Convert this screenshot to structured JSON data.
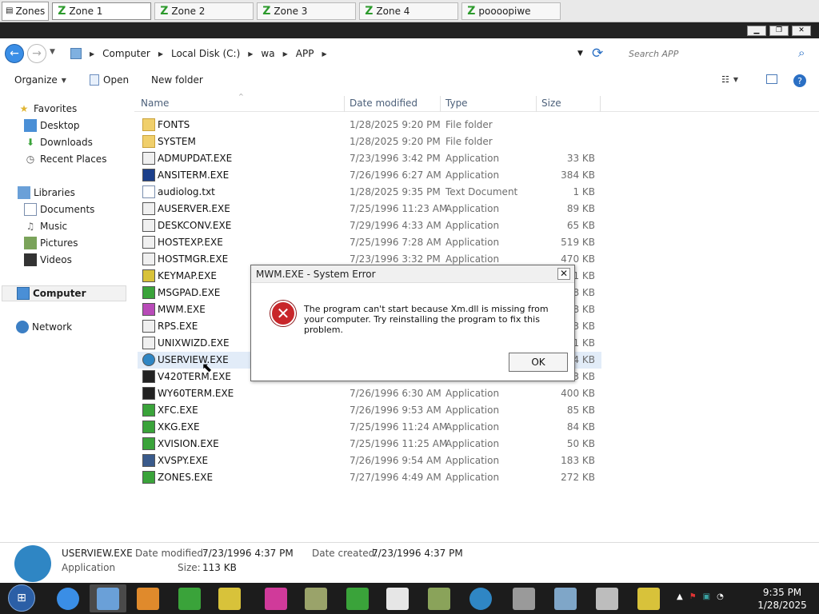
{
  "zones_bar": {
    "zones_label": "Zones",
    "tabs": [
      {
        "label": "Zone 1",
        "active": true
      },
      {
        "label": "Zone 2",
        "active": false
      },
      {
        "label": "Zone 3",
        "active": false
      },
      {
        "label": "Zone 4",
        "active": false
      },
      {
        "label": "poooopiwe",
        "active": false
      }
    ]
  },
  "address_bar": {
    "breadcrumb": [
      "Computer",
      "Local Disk (C:)",
      "wa",
      "APP"
    ],
    "search_placeholder": "Search APP"
  },
  "toolbar": {
    "organize": "Organize",
    "open": "Open",
    "new_folder": "New folder"
  },
  "sidebar": {
    "favorites": "Favorites",
    "desktop": "Desktop",
    "downloads": "Downloads",
    "recent_places": "Recent Places",
    "libraries": "Libraries",
    "documents": "Documents",
    "music": "Music",
    "pictures": "Pictures",
    "videos": "Videos",
    "computer": "Computer",
    "network": "Network"
  },
  "columns": {
    "name": "Name",
    "date_modified": "Date modified",
    "type": "Type",
    "size": "Size"
  },
  "files": [
    {
      "name": "FONTS",
      "date": "1/28/2025 9:20 PM",
      "type": "File folder",
      "size": "",
      "icon": "folder-icon"
    },
    {
      "name": "SYSTEM",
      "date": "1/28/2025 9:20 PM",
      "type": "File folder",
      "size": "",
      "icon": "folder-icon"
    },
    {
      "name": "ADMUPDAT.EXE",
      "date": "7/23/1996 3:42 PM",
      "type": "Application",
      "size": "33 KB",
      "icon": "app-icon"
    },
    {
      "name": "ANSITERM.EXE",
      "date": "7/26/1996 6:27 AM",
      "type": "Application",
      "size": "384 KB",
      "icon": "app-icon"
    },
    {
      "name": "audiolog.txt",
      "date": "1/28/2025 9:35 PM",
      "type": "Text Document",
      "size": "1 KB",
      "icon": "text-document-icon"
    },
    {
      "name": "AUSERVER.EXE",
      "date": "7/25/1996 11:23 AM",
      "type": "Application",
      "size": "89 KB",
      "icon": "app-icon"
    },
    {
      "name": "DESKCONV.EXE",
      "date": "7/29/1996 4:33 AM",
      "type": "Application",
      "size": "65 KB",
      "icon": "app-icon"
    },
    {
      "name": "HOSTEXP.EXE",
      "date": "7/25/1996 7:28 AM",
      "type": "Application",
      "size": "519 KB",
      "icon": "app-icon"
    },
    {
      "name": "HOSTMGR.EXE",
      "date": "7/23/1996 3:32 PM",
      "type": "Application",
      "size": "470 KB",
      "icon": "app-icon"
    },
    {
      "name": "KEYMAP.EXE",
      "date": "",
      "type": "",
      "size": "1 KB",
      "icon": "app-icon"
    },
    {
      "name": "MSGPAD.EXE",
      "date": "",
      "type": "",
      "size": "8 KB",
      "icon": "app-icon"
    },
    {
      "name": "MWM.EXE",
      "date": "",
      "type": "",
      "size": "8 KB",
      "icon": "app-icon"
    },
    {
      "name": "RPS.EXE",
      "date": "",
      "type": "",
      "size": "3 KB",
      "icon": "app-icon"
    },
    {
      "name": "UNIXWIZD.EXE",
      "date": "",
      "type": "",
      "size": "1 KB",
      "icon": "app-icon"
    },
    {
      "name": "USERVIEW.EXE",
      "date": "",
      "type": "",
      "size": "4 KB",
      "icon": "app-icon"
    },
    {
      "name": "V420TERM.EXE",
      "date": "",
      "type": "",
      "size": "3 KB",
      "icon": "app-icon"
    },
    {
      "name": "WY60TERM.EXE",
      "date": "7/26/1996 6:30 AM",
      "type": "Application",
      "size": "400 KB",
      "icon": "app-icon"
    },
    {
      "name": "XFC.EXE",
      "date": "7/26/1996 9:53 AM",
      "type": "Application",
      "size": "85 KB",
      "icon": "app-icon"
    },
    {
      "name": "XKG.EXE",
      "date": "7/25/1996 11:24 AM",
      "type": "Application",
      "size": "84 KB",
      "icon": "app-icon"
    },
    {
      "name": "XVISION.EXE",
      "date": "7/25/1996 11:25 AM",
      "type": "Application",
      "size": "50 KB",
      "icon": "app-icon"
    },
    {
      "name": "XVSPY.EXE",
      "date": "7/26/1996 9:54 AM",
      "type": "Application",
      "size": "183 KB",
      "icon": "app-icon"
    },
    {
      "name": "ZONES.EXE",
      "date": "7/27/1996 4:49 AM",
      "type": "Application",
      "size": "272 KB",
      "icon": "app-icon"
    }
  ],
  "dialog": {
    "title": "MWM.EXE - System Error",
    "message": "The program can't start because Xm.dll is missing from your computer. Try reinstalling the program to fix this problem.",
    "ok_label": "OK",
    "close_glyph": "✕"
  },
  "details_pane": {
    "filename": "USERVIEW.EXE",
    "file_type": "Application",
    "date_modified_label": "Date modified:",
    "date_modified": "7/23/1996 4:37 PM",
    "date_created_label": "Date created:",
    "date_created": "7/23/1996 4:37 PM",
    "size_label": "Size:",
    "size": "113 KB"
  },
  "taskbar": {
    "time": "9:35 PM",
    "date": "1/28/2025"
  },
  "colors": {
    "accent_blue": "#3a8ee6",
    "error_red": "#c8262a",
    "selection": "#e2ecf8",
    "zone_green": "#2c9a2c",
    "taskbar": "#1c1c1c"
  }
}
